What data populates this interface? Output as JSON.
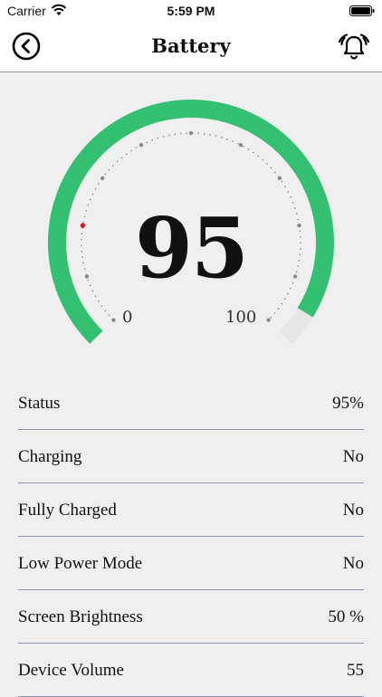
{
  "status_bar": {
    "carrier": "Carrier",
    "time": "5:59 PM"
  },
  "nav": {
    "title": "Battery",
    "back_icon": "back-circle-chevron-icon",
    "alarm_icon": "alarm-bell-icon"
  },
  "gauge": {
    "value": "95",
    "level": 95,
    "min_label": "0",
    "max_label": "100",
    "colors": {
      "fill": "#33c072",
      "track": "#e6e6e6",
      "marker": "#e21b1b",
      "ticks": "#8a8a8a"
    }
  },
  "rows": [
    {
      "label": "Status",
      "value": "95%"
    },
    {
      "label": "Charging",
      "value": "No"
    },
    {
      "label": "Fully Charged",
      "value": "No"
    },
    {
      "label": "Low Power Mode",
      "value": "No"
    },
    {
      "label": "Screen Brightness",
      "value": "50 %"
    },
    {
      "label": "Device Volume",
      "value": "55"
    }
  ]
}
